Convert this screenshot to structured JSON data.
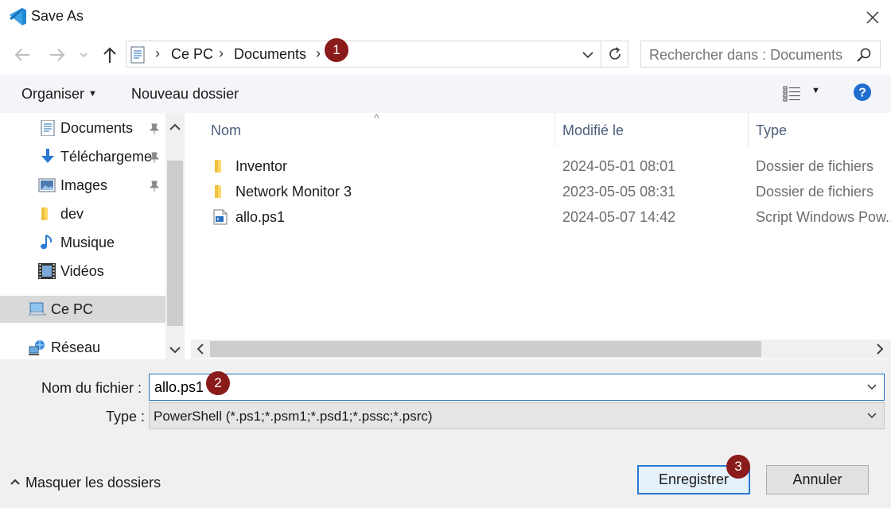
{
  "window": {
    "title": "Save As",
    "app_icon": "vscode-icon",
    "close_icon": "close-icon"
  },
  "address": {
    "crumbs": [
      "Ce PC",
      "Documents"
    ],
    "search_placeholder": "Rechercher dans : Documents"
  },
  "toolbar": {
    "organize": "Organiser",
    "new_folder": "Nouveau dossier"
  },
  "nav": {
    "items": [
      {
        "label": "Documents",
        "icon": "documents-icon",
        "pinned": true
      },
      {
        "label": "Téléchargeme",
        "icon": "download-icon",
        "pinned": true
      },
      {
        "label": "Images",
        "icon": "images-icon",
        "pinned": true
      },
      {
        "label": "dev",
        "icon": "folder-icon",
        "pinned": false
      },
      {
        "label": "Musique",
        "icon": "music-icon",
        "pinned": false
      },
      {
        "label": "Vidéos",
        "icon": "videos-icon",
        "pinned": false
      },
      {
        "label": "Ce PC",
        "icon": "computer-icon",
        "pinned": false,
        "selected": true
      },
      {
        "label": "Réseau",
        "icon": "network-icon",
        "pinned": false
      }
    ]
  },
  "files": {
    "columns": {
      "name": "Nom",
      "modified": "Modifié le",
      "type": "Type"
    },
    "rows": [
      {
        "name": "Inventor",
        "modified": "2024-05-01 08:01",
        "type": "Dossier de fichiers",
        "icon": "folder-icon"
      },
      {
        "name": "Network Monitor 3",
        "modified": "2023-05-05 08:31",
        "type": "Dossier de fichiers",
        "icon": "folder-icon"
      },
      {
        "name": "allo.ps1",
        "modified": "2024-05-07 14:42",
        "type": "Script Windows Pow...",
        "icon": "powershell-script-icon"
      }
    ]
  },
  "form": {
    "filename_label": "Nom du fichier :",
    "filename_value": "allo.ps1",
    "type_label": "Type :",
    "type_value": "PowerShell (*.ps1;*.psm1;*.psd1;*.pssc;*.psrc)"
  },
  "footer": {
    "hide_folders": "Masquer les dossiers",
    "save": "Enregistrer",
    "cancel": "Annuler"
  },
  "badges": [
    "1",
    "2",
    "3"
  ],
  "colors": {
    "accent": "#2a7ad4",
    "badge": "#8b1a1a",
    "toolbar_bg": "#f3f5f8",
    "footer_bg": "#f0f0f0"
  }
}
